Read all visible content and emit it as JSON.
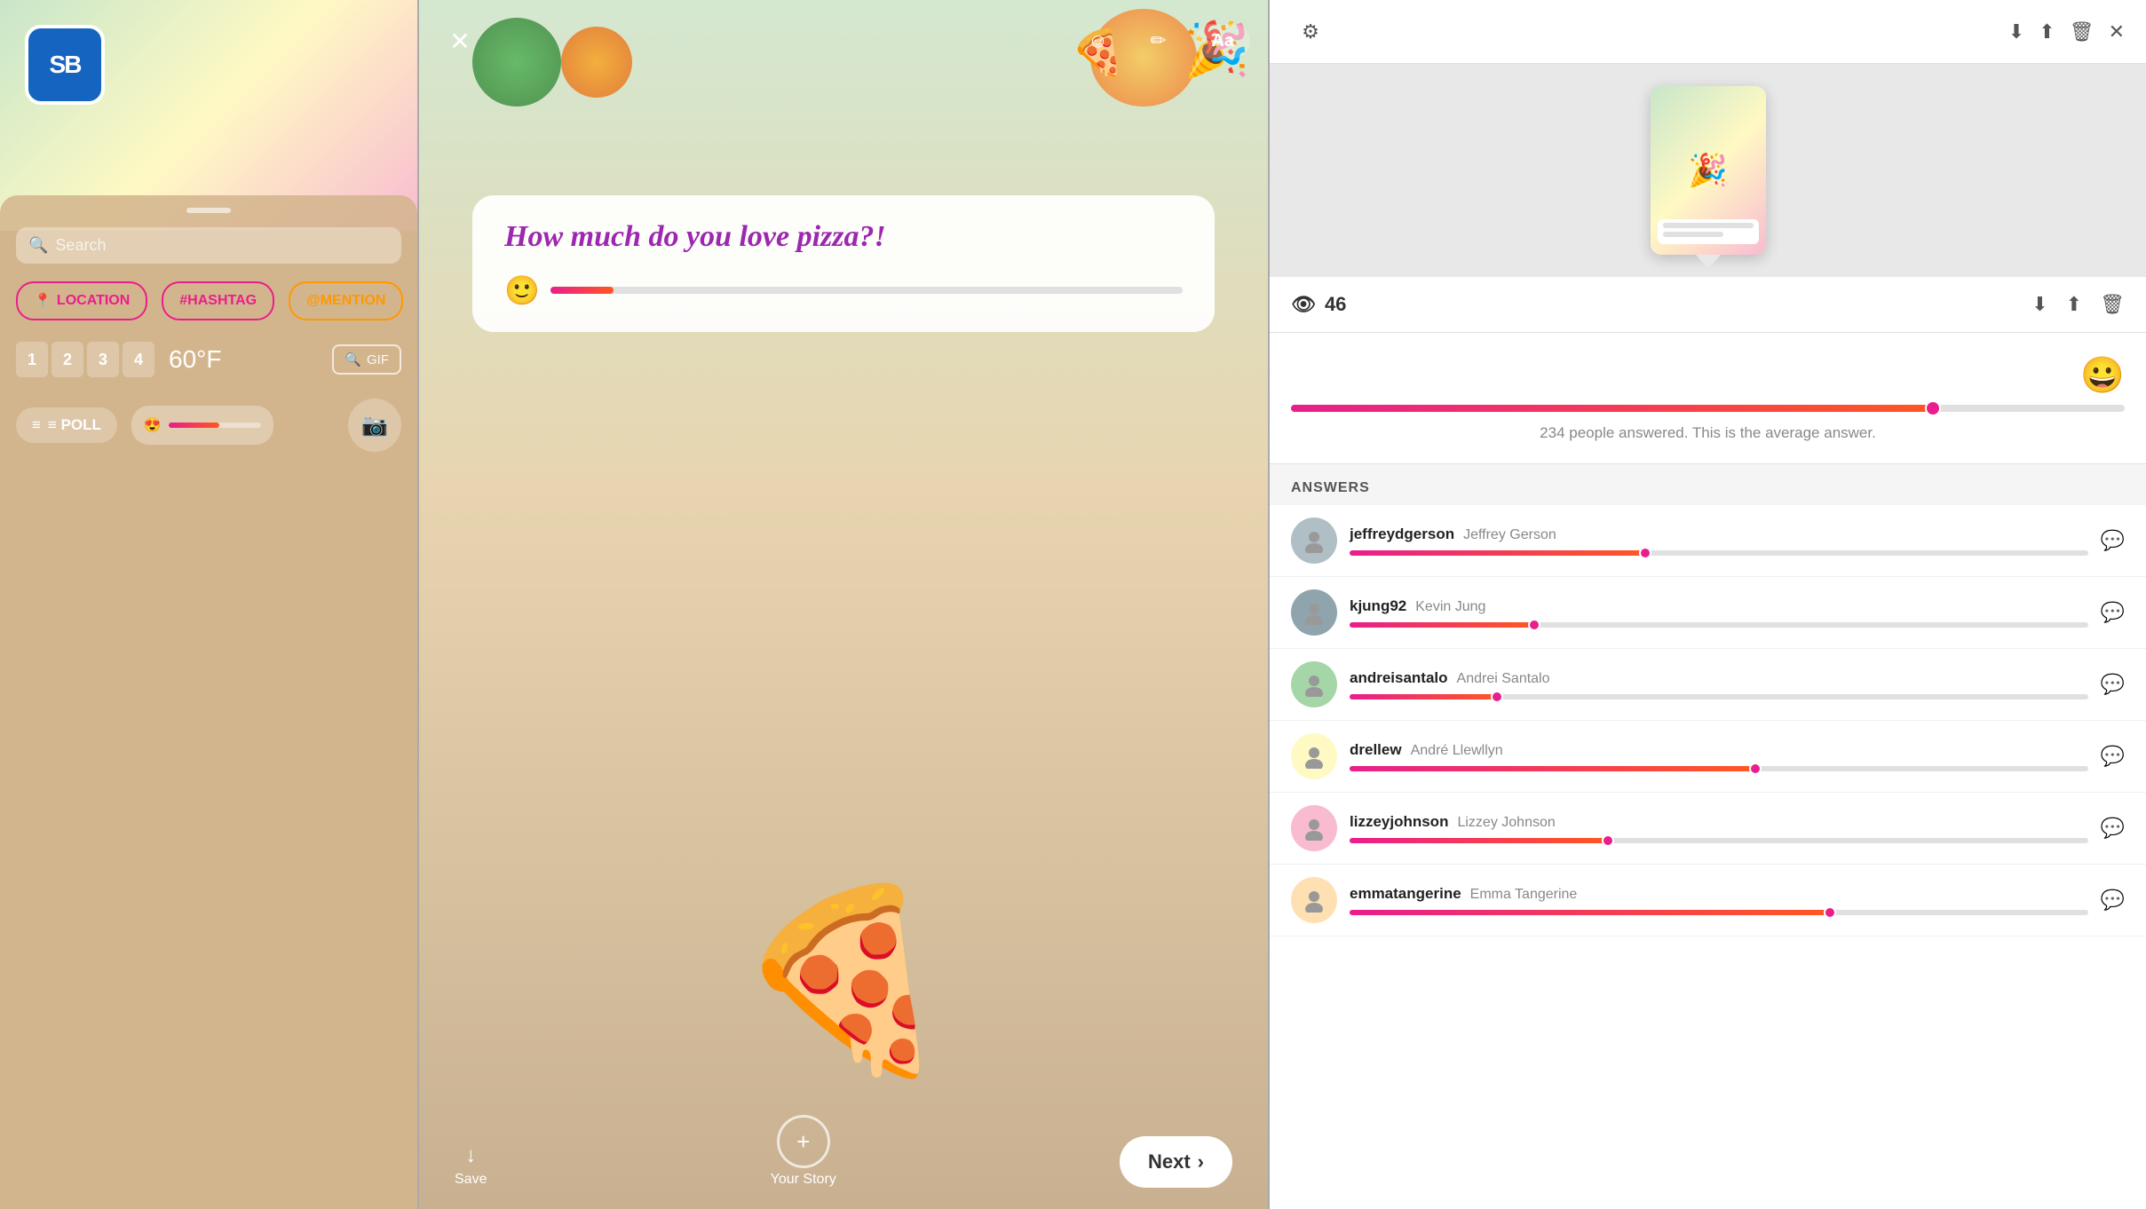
{
  "panel1": {
    "logo_text": "SB",
    "search_placeholder": "Search",
    "stickers": [
      {
        "label": "📍 LOCATION",
        "type": "location"
      },
      {
        "label": "#HASHTAG",
        "type": "hashtag"
      },
      {
        "label": "@MENTION",
        "type": "mention"
      }
    ],
    "countdown": [
      "1",
      "2",
      "3",
      "4"
    ],
    "temperature": "60°F",
    "gif_label": "🔍 GIF",
    "poll_label": "≡ POLL",
    "slider_emoji": "😍",
    "camera_icon": "📷"
  },
  "panel2": {
    "close_icon": "✕",
    "sticker_icon": "☺",
    "brush_icon": "✏",
    "text_btn": "Aa",
    "question": "How much do you love pizza?!",
    "slider_emoji": "🙂",
    "save_label": "Save",
    "save_icon": "↓",
    "story_label": "Your Story",
    "story_icon": "+",
    "next_label": "Next",
    "next_chevron": "›",
    "pizza_emoji": "🍕"
  },
  "panel3": {
    "settings_icon": "⚙",
    "download_icon": "↓",
    "share_icon": "↑",
    "delete_icon": "🗑",
    "views_count": "46",
    "views_icon": "👁",
    "slider_emoji": "😀",
    "answer_desc": "234 people answered. This is the average answer.",
    "answers_header": "ANSWERS",
    "answers": [
      {
        "username": "jeffreydgerson",
        "realname": "Jeffrey Gerson",
        "slider_pct": 40,
        "avatar_color": "#b0bec5",
        "avatar_emoji": "👤"
      },
      {
        "username": "kjung92",
        "realname": "Kevin Jung",
        "slider_pct": 25,
        "avatar_color": "#90a4ae",
        "avatar_emoji": "👤"
      },
      {
        "username": "andreisantalo",
        "realname": "Andrei Santalo",
        "slider_pct": 20,
        "avatar_color": "#a5d6a7",
        "avatar_emoji": "👤"
      },
      {
        "username": "drellew",
        "realname": "André Llewllyn",
        "slider_pct": 55,
        "avatar_color": "#fff9c4",
        "avatar_emoji": "👤"
      },
      {
        "username": "lizzeyjohnson",
        "realname": "Lizzey Johnson",
        "slider_pct": 35,
        "avatar_color": "#f8bbd0",
        "avatar_emoji": "👤"
      },
      {
        "username": "emmatangerine",
        "realname": "Emma Tangerine",
        "slider_pct": 65,
        "avatar_color": "#ffe0b2",
        "avatar_emoji": "👤"
      }
    ]
  }
}
